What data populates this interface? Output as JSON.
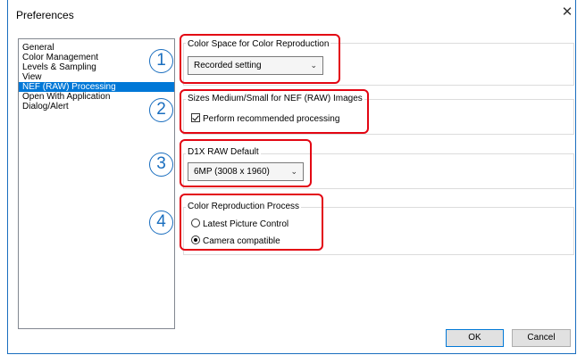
{
  "window": {
    "title": "Preferences",
    "close_glyph": "✕"
  },
  "sidebar": {
    "items": [
      {
        "label": "General",
        "selected": false
      },
      {
        "label": "Color Management",
        "selected": false
      },
      {
        "label": "Levels & Sampling",
        "selected": false
      },
      {
        "label": "View",
        "selected": false
      },
      {
        "label": "NEF (RAW) Processing",
        "selected": true
      },
      {
        "label": "Open With Application",
        "selected": false
      },
      {
        "label": "Dialog/Alert",
        "selected": false
      }
    ]
  },
  "sections": {
    "color_space": {
      "number": "1",
      "title": "Color Space for Color Reproduction",
      "value": "Recorded setting"
    },
    "sizes": {
      "number": "2",
      "title": "Sizes Medium/Small for NEF (RAW) Images",
      "checkbox_label": "Perform recommended processing",
      "checked": true
    },
    "d1x": {
      "number": "3",
      "title": "D1X RAW Default",
      "value": "6MP (3008 x 1960)"
    },
    "process": {
      "number": "4",
      "title": "Color Reproduction Process",
      "options": [
        {
          "label": "Latest Picture Control",
          "selected": false
        },
        {
          "label": "Camera compatible",
          "selected": true
        }
      ]
    }
  },
  "buttons": {
    "ok": "OK",
    "cancel": "Cancel"
  },
  "colors": {
    "highlight": "#e30613",
    "number_badge": "#1a6ebf",
    "selection": "#0078d7"
  }
}
